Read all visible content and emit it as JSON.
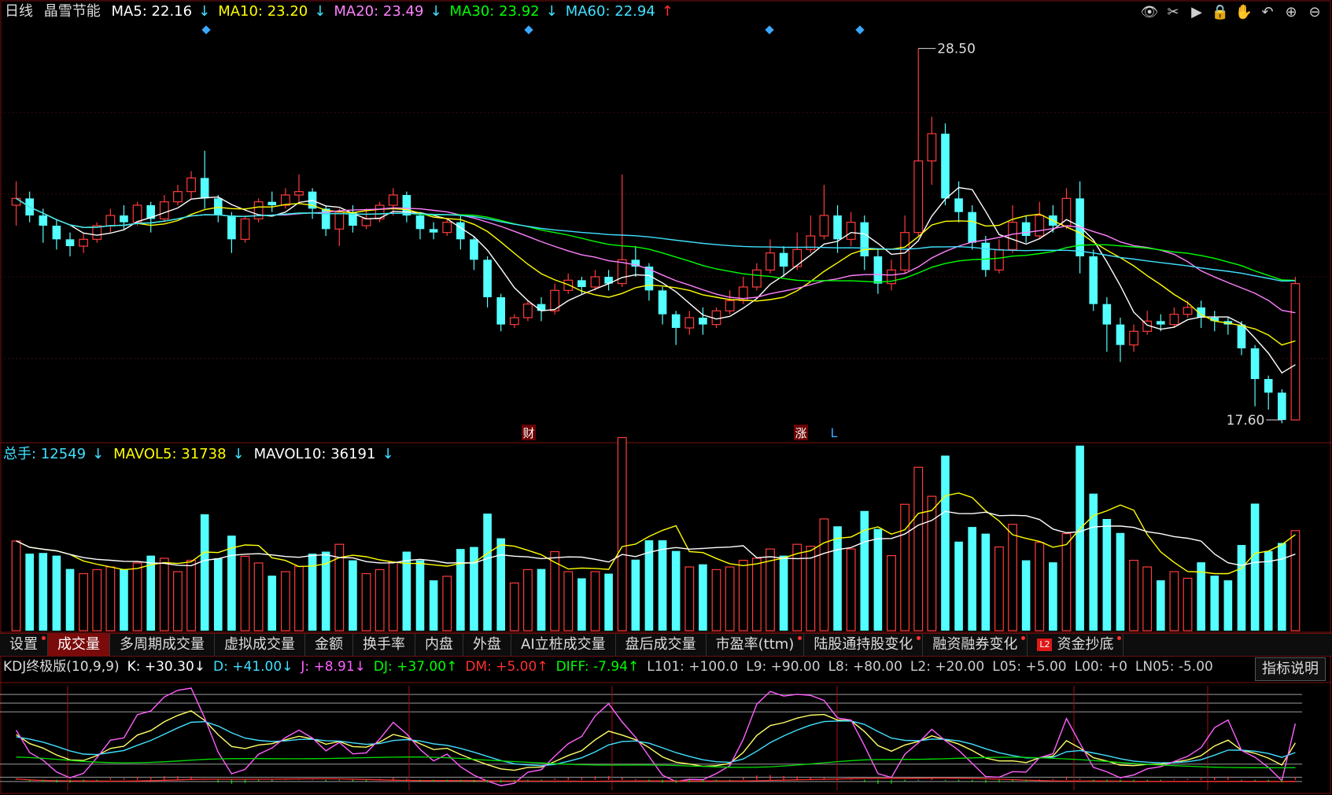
{
  "header": {
    "period": "日线",
    "stock": "晶雪节能",
    "ma": [
      {
        "label": "MA5:",
        "value": "22.16",
        "arrow": "↓",
        "color": "#ffffff"
      },
      {
        "label": "MA10:",
        "value": "23.20",
        "arrow": "↓",
        "color": "#ffff00"
      },
      {
        "label": "MA20:",
        "value": "23.49",
        "arrow": "↓",
        "color": "#ff80ff"
      },
      {
        "label": "MA30:",
        "value": "23.92",
        "arrow": "↓",
        "color": "#00ff00"
      },
      {
        "label": "MA60:",
        "value": "22.94",
        "arrow": "↑",
        "color": "#40e0ff"
      }
    ]
  },
  "toolbar": [
    {
      "name": "eye-icon",
      "glyph": "👁"
    },
    {
      "name": "scissors-icon",
      "glyph": "✂"
    },
    {
      "name": "play-icon",
      "glyph": "▶"
    },
    {
      "name": "lock-icon",
      "glyph": "🔒"
    },
    {
      "name": "hand-icon",
      "glyph": "✋"
    },
    {
      "name": "undo-icon",
      "glyph": "↶"
    },
    {
      "name": "zoom-in-icon",
      "glyph": "⊕"
    },
    {
      "name": "zoom-out-icon",
      "glyph": "⊖"
    }
  ],
  "markers": {
    "cai": "财",
    "zhang": "涨",
    "l": "L",
    "high": "28.50",
    "low": "17.60"
  },
  "volume_header": {
    "items": [
      {
        "label": "总手:",
        "value": "12549",
        "arrow": "↓",
        "color": "#40e0ff"
      },
      {
        "label": "MAVOL5:",
        "value": "31738",
        "arrow": "↓",
        "color": "#ffff00"
      },
      {
        "label": "MAVOL10:",
        "value": "36191",
        "arrow": "↓",
        "color": "#ffffff"
      }
    ]
  },
  "tabs": [
    {
      "label": "设置",
      "active": false,
      "dot": true
    },
    {
      "label": "成交量",
      "active": true,
      "dot": false
    },
    {
      "label": "多周期成交量",
      "active": false,
      "dot": false
    },
    {
      "label": "虚拟成交量",
      "active": false,
      "dot": false
    },
    {
      "label": "金额",
      "active": false,
      "dot": false
    },
    {
      "label": "换手率",
      "active": false,
      "dot": false
    },
    {
      "label": "内盘",
      "active": false,
      "dot": false
    },
    {
      "label": "外盘",
      "active": false,
      "dot": false
    },
    {
      "label": "AI立桩成交量",
      "active": false,
      "dot": false
    },
    {
      "label": "盘后成交量",
      "active": false,
      "dot": false
    },
    {
      "label": "市盈率(ttm)",
      "active": false,
      "dot": true
    },
    {
      "label": "陆股通持股变化",
      "active": false,
      "dot": true
    },
    {
      "label": "融资融券变化",
      "active": false,
      "dot": true
    },
    {
      "label": "资金抄底",
      "active": false,
      "dot": true,
      "badge": "L2"
    }
  ],
  "kdj_header": {
    "items": [
      {
        "text": "KDJ终极版(10,9,9)",
        "color": "#dddddd"
      },
      {
        "text": "K: +30.30↓",
        "color": "#ffffff"
      },
      {
        "text": "D: +41.00↓",
        "color": "#40e0ff"
      },
      {
        "text": "J: +8.91↓",
        "color": "#ff60ff"
      },
      {
        "text": "DJ: +37.00↑",
        "color": "#00ff00"
      },
      {
        "text": "DM: +5.00↑",
        "color": "#ff3030"
      },
      {
        "text": "DIFF: -7.94↑",
        "color": "#00ff00"
      },
      {
        "text": "L101: +100.0",
        "color": "#cccccc"
      },
      {
        "text": "L9: +90.00",
        "color": "#cccccc"
      },
      {
        "text": "L8: +80.00",
        "color": "#cccccc"
      },
      {
        "text": "L2: +20.00",
        "color": "#cccccc"
      },
      {
        "text": "L05: +5.00",
        "color": "#cccccc"
      },
      {
        "text": "L00: +0",
        "color": "#cccccc"
      },
      {
        "text": "LN05: -5.00",
        "color": "#cccccc"
      }
    ],
    "help": "指标说明"
  },
  "chart_data": {
    "type": "candlestick",
    "ylim": [
      17.0,
      29.0
    ],
    "high_mark": 28.5,
    "low_mark": 17.6,
    "candles": [
      [
        23.9,
        24.1,
        23.3,
        24.6
      ],
      [
        24.1,
        23.6,
        23.4,
        24.3
      ],
      [
        23.6,
        23.3,
        22.8,
        23.8
      ],
      [
        23.3,
        22.9,
        22.6,
        23.5
      ],
      [
        22.9,
        22.7,
        22.4,
        23.1
      ],
      [
        22.7,
        22.9,
        22.5,
        23.1
      ],
      [
        22.9,
        23.3,
        22.8,
        23.4
      ],
      [
        23.3,
        23.6,
        23.1,
        23.8
      ],
      [
        23.6,
        23.4,
        23.2,
        23.9
      ],
      [
        23.4,
        23.9,
        23.3,
        24.0
      ],
      [
        23.9,
        23.5,
        23.1,
        24.0
      ],
      [
        23.5,
        24.0,
        23.4,
        24.2
      ],
      [
        24.0,
        24.3,
        23.9,
        24.5
      ],
      [
        24.3,
        24.7,
        24.1,
        24.9
      ],
      [
        24.7,
        24.1,
        23.8,
        25.5
      ],
      [
        24.1,
        23.6,
        23.4,
        24.2
      ],
      [
        23.6,
        22.9,
        22.5,
        23.7
      ],
      [
        22.9,
        23.5,
        22.8,
        23.6
      ],
      [
        23.5,
        24.0,
        23.4,
        24.1
      ],
      [
        24.0,
        23.9,
        23.7,
        24.3
      ],
      [
        23.9,
        24.2,
        23.8,
        24.4
      ],
      [
        24.2,
        24.3,
        24.0,
        24.8
      ],
      [
        24.3,
        23.8,
        23.5,
        24.4
      ],
      [
        23.8,
        23.2,
        23.0,
        23.9
      ],
      [
        23.2,
        23.7,
        22.7,
        23.8
      ],
      [
        23.7,
        23.3,
        23.1,
        23.9
      ],
      [
        23.3,
        23.5,
        23.2,
        23.8
      ],
      [
        23.5,
        23.9,
        23.4,
        24.0
      ],
      [
        23.9,
        24.2,
        23.6,
        24.4
      ],
      [
        24.2,
        23.6,
        23.4,
        24.3
      ],
      [
        23.6,
        23.2,
        22.9,
        23.7
      ],
      [
        23.2,
        23.1,
        22.9,
        23.4
      ],
      [
        23.1,
        23.4,
        23.0,
        23.5
      ],
      [
        23.4,
        22.9,
        22.6,
        23.6
      ],
      [
        22.9,
        22.3,
        22.0,
        23.0
      ],
      [
        22.3,
        21.2,
        20.9,
        22.4
      ],
      [
        21.2,
        20.4,
        20.2,
        21.3
      ],
      [
        20.4,
        20.6,
        20.3,
        20.7
      ],
      [
        20.6,
        21.0,
        20.5,
        21.1
      ],
      [
        21.0,
        20.8,
        20.5,
        21.2
      ],
      [
        20.8,
        21.4,
        20.7,
        21.6
      ],
      [
        21.4,
        21.7,
        21.3,
        21.9
      ],
      [
        21.7,
        21.5,
        21.3,
        21.8
      ],
      [
        21.5,
        21.8,
        21.4,
        22.0
      ],
      [
        21.8,
        21.6,
        21.4,
        22.0
      ],
      [
        21.6,
        22.3,
        21.5,
        24.8
      ],
      [
        22.3,
        22.1,
        21.8,
        22.7
      ],
      [
        22.1,
        21.4,
        21.1,
        22.2
      ],
      [
        21.4,
        20.7,
        20.4,
        21.5
      ],
      [
        20.7,
        20.3,
        19.8,
        20.8
      ],
      [
        20.3,
        20.6,
        20.1,
        20.8
      ],
      [
        20.6,
        20.4,
        20.1,
        20.9
      ],
      [
        20.4,
        20.8,
        20.3,
        20.9
      ],
      [
        20.8,
        21.1,
        20.7,
        21.4
      ],
      [
        21.1,
        21.5,
        21.0,
        21.8
      ],
      [
        21.5,
        22.0,
        21.4,
        22.2
      ],
      [
        22.0,
        22.5,
        21.9,
        22.9
      ],
      [
        22.5,
        22.1,
        21.8,
        22.7
      ],
      [
        22.1,
        22.6,
        22.0,
        23.1
      ],
      [
        22.6,
        23.0,
        22.5,
        23.6
      ],
      [
        23.0,
        23.6,
        22.9,
        24.5
      ],
      [
        23.6,
        22.9,
        22.5,
        23.9
      ],
      [
        22.9,
        23.4,
        22.7,
        23.7
      ],
      [
        23.4,
        22.4,
        22.0,
        23.6
      ],
      [
        22.4,
        21.6,
        21.3,
        22.6
      ],
      [
        21.6,
        22.0,
        21.4,
        22.3
      ],
      [
        22.0,
        23.1,
        21.9,
        23.6
      ],
      [
        23.1,
        25.2,
        23.0,
        28.5
      ],
      [
        25.2,
        26.0,
        24.5,
        26.5
      ],
      [
        26.0,
        24.1,
        23.9,
        26.3
      ],
      [
        24.1,
        23.7,
        23.4,
        24.6
      ],
      [
        23.7,
        22.8,
        22.6,
        23.9
      ],
      [
        22.8,
        22.0,
        21.8,
        23.0
      ],
      [
        22.0,
        22.6,
        21.9,
        22.9
      ],
      [
        22.6,
        23.4,
        22.5,
        23.9
      ],
      [
        23.4,
        23.0,
        22.8,
        23.6
      ],
      [
        23.0,
        23.6,
        22.9,
        24.0
      ],
      [
        23.6,
        23.3,
        23.1,
        23.9
      ],
      [
        23.3,
        24.1,
        23.2,
        24.4
      ],
      [
        24.1,
        22.4,
        21.9,
        24.6
      ],
      [
        22.4,
        21.0,
        20.8,
        22.6
      ],
      [
        21.0,
        20.4,
        19.6,
        21.2
      ],
      [
        20.4,
        19.8,
        19.3,
        20.6
      ],
      [
        19.8,
        20.2,
        19.6,
        20.4
      ],
      [
        20.2,
        20.5,
        20.1,
        20.8
      ],
      [
        20.5,
        20.4,
        20.2,
        20.7
      ],
      [
        20.4,
        20.7,
        20.3,
        20.9
      ],
      [
        20.7,
        20.9,
        20.6,
        21.1
      ],
      [
        20.9,
        20.6,
        20.3,
        21.1
      ],
      [
        20.6,
        20.5,
        20.2,
        20.8
      ],
      [
        20.5,
        20.4,
        20.1,
        20.6
      ],
      [
        20.4,
        19.7,
        19.5,
        20.5
      ],
      [
        19.7,
        18.8,
        18.0,
        19.8
      ],
      [
        18.8,
        18.4,
        17.9,
        18.9
      ],
      [
        18.4,
        17.6,
        17.5,
        18.5
      ],
      [
        17.6,
        21.6,
        17.6,
        21.8
      ]
    ],
    "volume": {
      "ylim": [
        0,
        100000
      ]
    },
    "kdj": {
      "ylim": [
        -10,
        110
      ]
    }
  }
}
